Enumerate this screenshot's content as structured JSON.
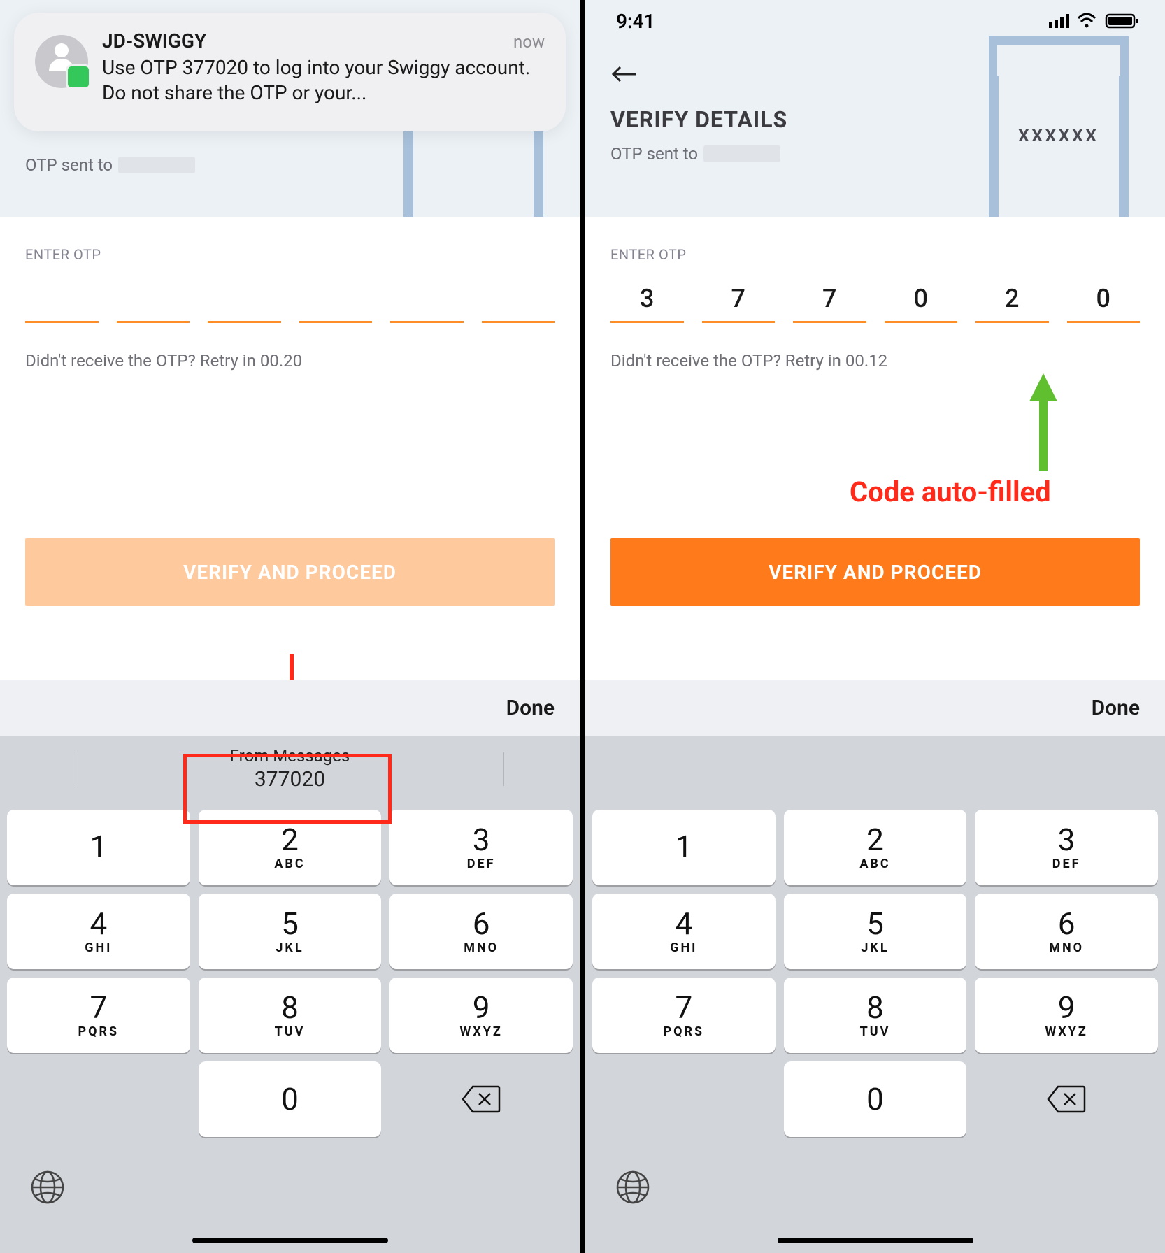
{
  "left": {
    "notification": {
      "sender": "JD-SWIGGY",
      "time": "now",
      "message": "Use OTP 377020 to log into your Swiggy account. Do not share the OTP or your..."
    },
    "header": {
      "otp_sent_label": "OTP sent to"
    },
    "enter_otp_label": "ENTER OTP",
    "otp_values": [
      "",
      "",
      "",
      "",
      "",
      ""
    ],
    "retry_text": "Didn't receive the OTP? Retry in 00.20",
    "verify_button": "VERIFY AND PROCEED",
    "keyboard": {
      "done": "Done",
      "suggestion_label": "From Messages",
      "suggestion_code": "377020"
    }
  },
  "right": {
    "status_time": "9:41",
    "header": {
      "title": "VERIFY DETAILS",
      "otp_sent_label": "OTP sent to",
      "placeholder": "XXXXXX"
    },
    "enter_otp_label": "ENTER OTP",
    "otp_values": [
      "3",
      "7",
      "7",
      "0",
      "2",
      "0"
    ],
    "retry_text": "Didn't receive the OTP? Retry in 00.12",
    "verify_button": "VERIFY AND PROCEED",
    "keyboard": {
      "done": "Done"
    },
    "annotation": "Code auto-filled"
  },
  "keypad": [
    {
      "n": "1",
      "l": ""
    },
    {
      "n": "2",
      "l": "ABC"
    },
    {
      "n": "3",
      "l": "DEF"
    },
    {
      "n": "4",
      "l": "GHI"
    },
    {
      "n": "5",
      "l": "JKL"
    },
    {
      "n": "6",
      "l": "MNO"
    },
    {
      "n": "7",
      "l": "PQRS"
    },
    {
      "n": "8",
      "l": "TUV"
    },
    {
      "n": "9",
      "l": "WXYZ"
    }
  ],
  "key_zero": "0"
}
